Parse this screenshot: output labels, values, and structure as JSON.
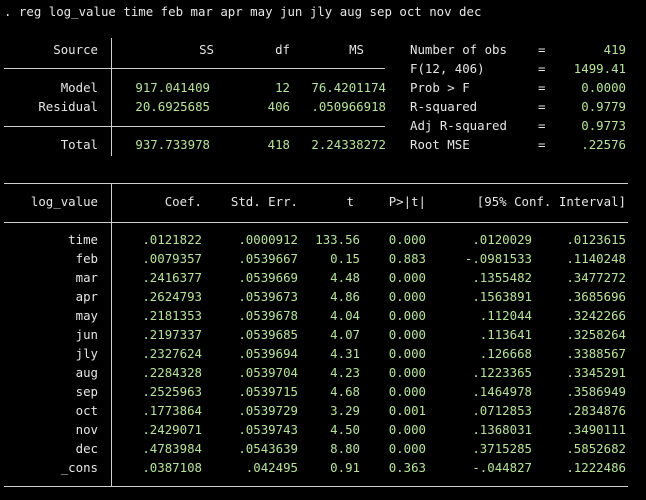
{
  "command": ". reg log_value time feb mar apr may jun jly aug sep oct nov dec",
  "anova": {
    "headers": {
      "source": "Source",
      "ss": "SS",
      "df": "df",
      "ms": "MS"
    },
    "rows": [
      {
        "source": "Model",
        "ss": "917.041409",
        "df": "12",
        "ms": "76.4201174"
      },
      {
        "source": "Residual",
        "ss": "20.6925685",
        "df": "406",
        "ms": ".050966918"
      }
    ],
    "total": {
      "source": "Total",
      "ss": "937.733978",
      "df": "418",
      "ms": "2.24338272"
    }
  },
  "stats": [
    {
      "label": "Number of obs",
      "eq": "=",
      "value": "419"
    },
    {
      "label": "F(12, 406)",
      "eq": "=",
      "value": "1499.41"
    },
    {
      "label": "Prob > F",
      "eq": "=",
      "value": "0.0000"
    },
    {
      "label": "R-squared",
      "eq": "=",
      "value": "0.9779"
    },
    {
      "label": "Adj R-squared",
      "eq": "=",
      "value": "0.9773"
    },
    {
      "label": "Root MSE",
      "eq": "=",
      "value": ".22576"
    }
  ],
  "coef_table": {
    "headers": {
      "var": "log_value",
      "coef": "Coef.",
      "se": "Std. Err.",
      "t": "t",
      "p": "P>|t|",
      "ci": "[95% Conf. Interval]"
    },
    "rows": [
      {
        "var": "time",
        "coef": ".0121822",
        "se": ".0000912",
        "t": "133.56",
        "p": "0.000",
        "lo": ".0120029",
        "hi": ".0123615"
      },
      {
        "var": "feb",
        "coef": ".0079357",
        "se": ".0539667",
        "t": "0.15",
        "p": "0.883",
        "lo": "-.0981533",
        "hi": ".1140248"
      },
      {
        "var": "mar",
        "coef": ".2416377",
        "se": ".0539669",
        "t": "4.48",
        "p": "0.000",
        "lo": ".1355482",
        "hi": ".3477272"
      },
      {
        "var": "apr",
        "coef": ".2624793",
        "se": ".0539673",
        "t": "4.86",
        "p": "0.000",
        "lo": ".1563891",
        "hi": ".3685696"
      },
      {
        "var": "may",
        "coef": ".2181353",
        "se": ".0539678",
        "t": "4.04",
        "p": "0.000",
        "lo": ".112044",
        "hi": ".3242266"
      },
      {
        "var": "jun",
        "coef": ".2197337",
        "se": ".0539685",
        "t": "4.07",
        "p": "0.000",
        "lo": ".113641",
        "hi": ".3258264"
      },
      {
        "var": "jly",
        "coef": ".2327624",
        "se": ".0539694",
        "t": "4.31",
        "p": "0.000",
        "lo": ".126668",
        "hi": ".3388567"
      },
      {
        "var": "aug",
        "coef": ".2284328",
        "se": ".0539704",
        "t": "4.23",
        "p": "0.000",
        "lo": ".1223365",
        "hi": ".3345291"
      },
      {
        "var": "sep",
        "coef": ".2525963",
        "se": ".0539715",
        "t": "4.68",
        "p": "0.000",
        "lo": ".1464978",
        "hi": ".3586949"
      },
      {
        "var": "oct",
        "coef": ".1773864",
        "se": ".0539729",
        "t": "3.29",
        "p": "0.001",
        "lo": ".0712853",
        "hi": ".2834876"
      },
      {
        "var": "nov",
        "coef": ".2429071",
        "se": ".0539743",
        "t": "4.50",
        "p": "0.000",
        "lo": ".1368031",
        "hi": ".3490111"
      },
      {
        "var": "dec",
        "coef": ".4783984",
        "se": ".0543639",
        "t": "8.80",
        "p": "0.000",
        "lo": ".3715285",
        "hi": ".5852682"
      },
      {
        "var": "_cons",
        "coef": ".0387108",
        "se": ".042495",
        "t": "0.91",
        "p": "0.363",
        "lo": "-.044827",
        "hi": ".1222486"
      }
    ]
  },
  "colors": {
    "background": "#000000",
    "text": "#e6e6e6",
    "value": "#b6e39a",
    "rule": "#cfcfcf"
  }
}
